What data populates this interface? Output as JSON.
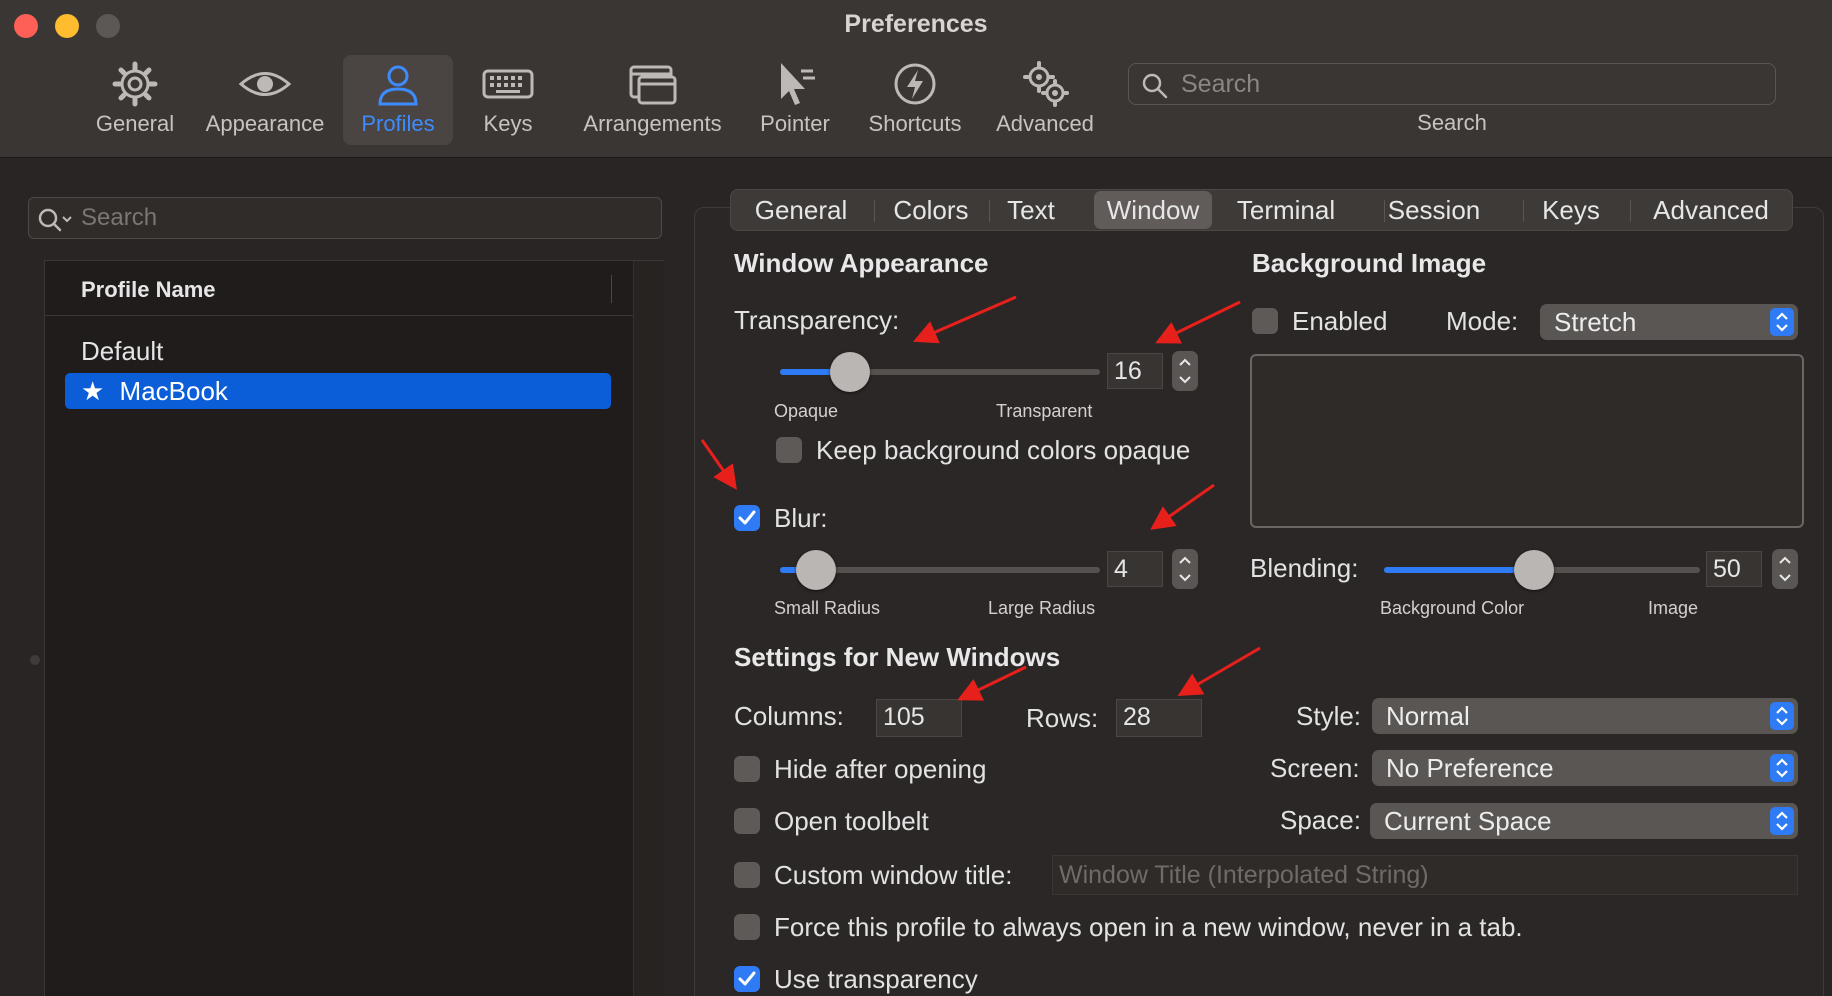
{
  "window": {
    "title": "Preferences"
  },
  "toolbar": {
    "items": [
      {
        "label": "General",
        "icon": "gear-icon"
      },
      {
        "label": "Appearance",
        "icon": "eye-icon"
      },
      {
        "label": "Profiles",
        "icon": "person-icon",
        "active": true
      },
      {
        "label": "Keys",
        "icon": "keyboard-icon"
      },
      {
        "label": "Arrangements",
        "icon": "windows-icon"
      },
      {
        "label": "Pointer",
        "icon": "pointer-icon"
      },
      {
        "label": "Shortcuts",
        "icon": "bolt-icon"
      },
      {
        "label": "Advanced",
        "icon": "gears-icon"
      }
    ],
    "search_placeholder": "Search",
    "search_label": "Search"
  },
  "profiles": {
    "search_placeholder": "Search",
    "column_header": "Profile Name",
    "items": [
      {
        "name": "Default",
        "selected": false
      },
      {
        "name": "MacBook",
        "selected": true,
        "star": "★"
      }
    ]
  },
  "tabs": [
    "General",
    "Colors",
    "Text",
    "Window",
    "Terminal",
    "Session",
    "Keys",
    "Advanced"
  ],
  "active_tab": "Window",
  "window_appearance": {
    "heading": "Window Appearance",
    "transparency_label": "Transparency:",
    "transparency_value": "16",
    "transparency_min_label": "Opaque",
    "transparency_max_label": "Transparent",
    "keep_bg_opaque_label": "Keep background colors opaque",
    "keep_bg_opaque_checked": false,
    "blur_label": "Blur:",
    "blur_checked": true,
    "blur_value": "4",
    "blur_min_label": "Small Radius",
    "blur_max_label": "Large Radius"
  },
  "background_image": {
    "heading": "Background Image",
    "enabled_label": "Enabled",
    "enabled_checked": false,
    "mode_label": "Mode:",
    "mode_value": "Stretch",
    "blending_label": "Blending:",
    "blending_value": "50",
    "blending_min_label": "Background Color",
    "blending_max_label": "Image"
  },
  "new_windows": {
    "heading": "Settings for New Windows",
    "columns_label": "Columns:",
    "columns_value": "105",
    "rows_label": "Rows:",
    "rows_value": "28",
    "style_label": "Style:",
    "style_value": "Normal",
    "screen_label": "Screen:",
    "screen_value": "No Preference",
    "space_label": "Space:",
    "space_value": "Current Space",
    "hide_after_opening_label": "Hide after opening",
    "open_toolbelt_label": "Open toolbelt",
    "custom_title_label": "Custom window title:",
    "custom_title_placeholder": "Window Title (Interpolated String)",
    "force_new_window_label": "Force this profile to always open in a new window, never in a tab.",
    "use_transparency_label": "Use transparency",
    "use_transparency_checked": true
  },
  "colors": {
    "accent": "#2f7bf5",
    "selection": "#0b5ed7",
    "annotation_arrow": "#e8201c"
  }
}
